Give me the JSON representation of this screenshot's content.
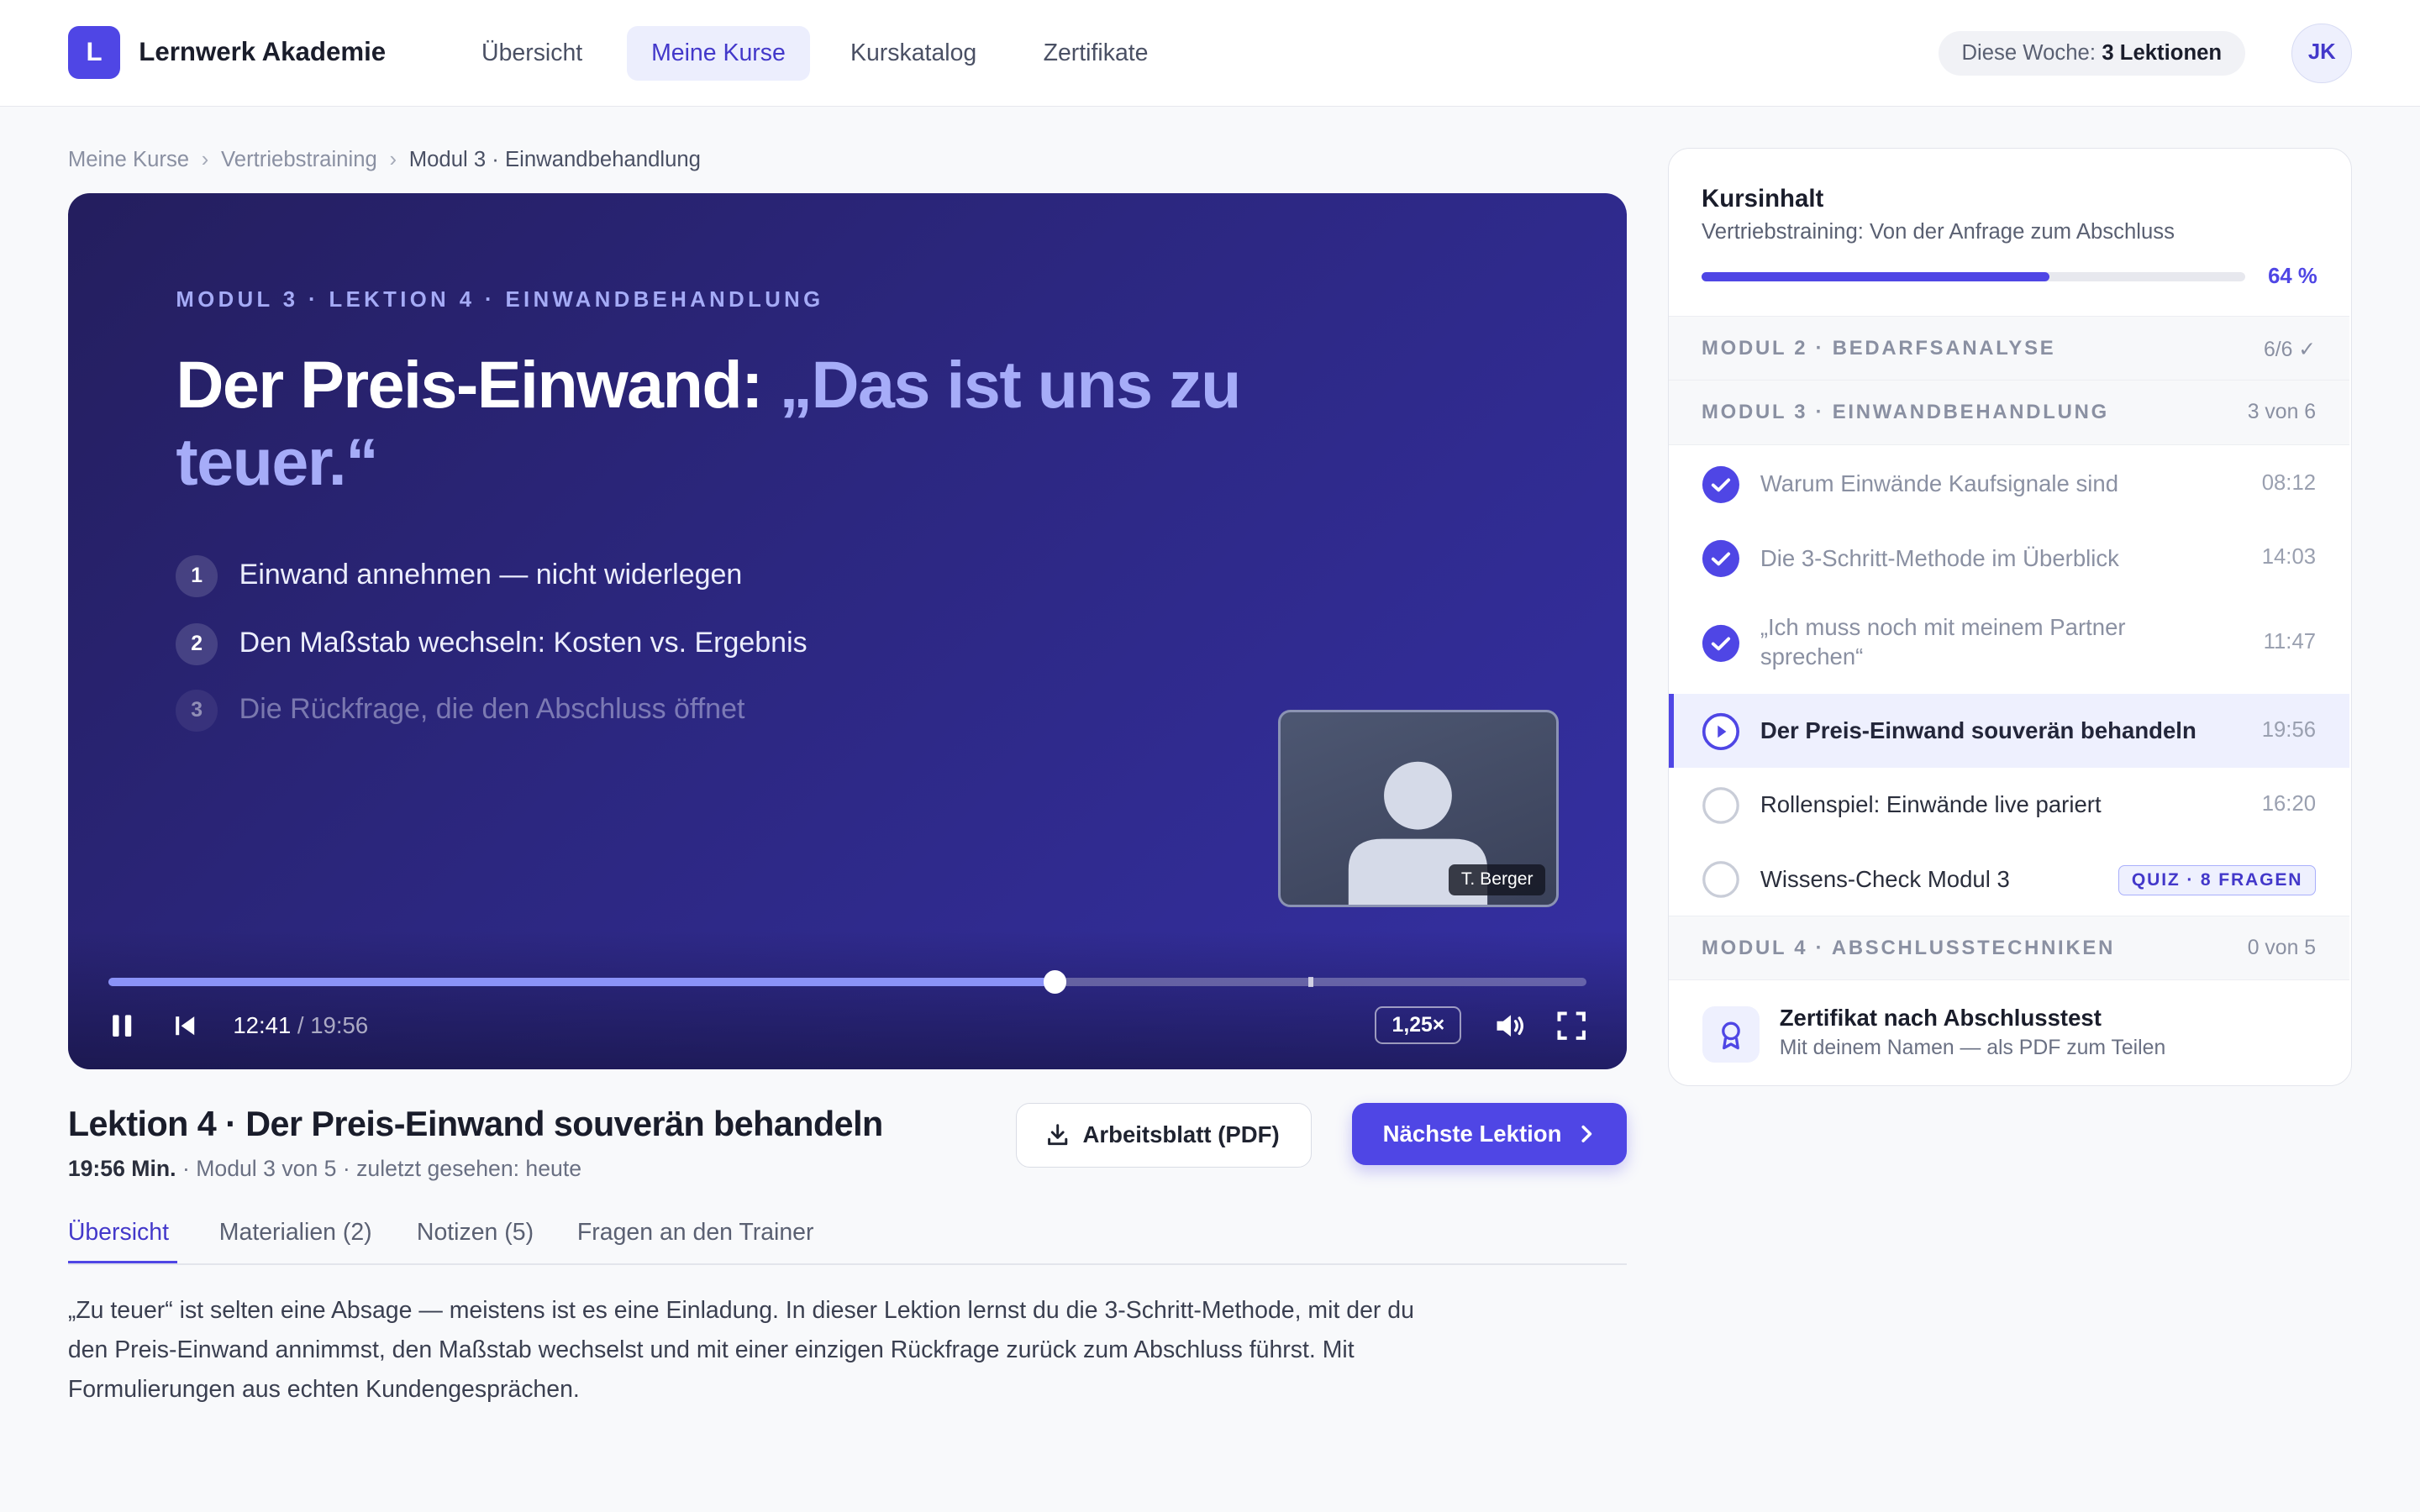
{
  "app": {
    "logo_letter": "L",
    "brand": "Lernwerk Akademie",
    "accent_color": "#4f46e5"
  },
  "nav": {
    "items": [
      {
        "label": "Übersicht",
        "active": false
      },
      {
        "label": "Meine Kurse",
        "active": true
      },
      {
        "label": "Kurskatalog",
        "active": false
      },
      {
        "label": "Zertifikate",
        "active": false
      }
    ]
  },
  "header": {
    "week_label": "Diese Woche:",
    "week_value": "3 Lektionen",
    "avatar_initials": "JK"
  },
  "breadcrumb": {
    "items": [
      "Meine Kurse",
      "Vertriebstraining",
      "Modul 3 · Einwandbehandlung"
    ],
    "separator": "›"
  },
  "video": {
    "eyebrow": "MODUL 3 · LEKTION 4 · EINWANDBEHANDLUNG",
    "title_main": "Der Preis-Einwand: ",
    "title_quote": "„Das ist uns zu teuer.“",
    "points": [
      {
        "num": "1",
        "text": "Einwand annehmen — nicht widerlegen"
      },
      {
        "num": "2",
        "text": "Den Maßstab wechseln: Kosten vs. Ergebnis"
      },
      {
        "num": "3",
        "text": "Die Rückfrage, die den Abschluss öffnet"
      }
    ],
    "presenter_name": "T. Berger",
    "current_time": "12:41",
    "duration": "/ 19:56",
    "progress_fraction": 0.64,
    "chapter_mark_fraction": 0.812,
    "speed": "1,25×",
    "icons": [
      "pause-icon",
      "skip-back-icon",
      "volume-icon",
      "fullscreen-icon"
    ]
  },
  "lesson": {
    "title": "Lektion 4 · Der Preis-Einwand souverän behandeln",
    "length": "19:56 Min.",
    "meta_rest": " · Modul 3 von 5 · zuletzt gesehen: heute",
    "worksheet_button": "Arbeitsblatt (PDF)",
    "next_button": "Nächste Lektion",
    "tabs": [
      {
        "label": "Übersicht",
        "active": true
      },
      {
        "label": "Materialien (2)",
        "active": false
      },
      {
        "label": "Notizen (5)",
        "active": false
      },
      {
        "label": "Fragen an den Trainer",
        "active": false
      }
    ],
    "description": "„Zu teuer“ ist selten eine Absage — meistens ist es eine Einladung. In dieser Lektion lernst du die 3-Schritt-Methode, mit der du den Preis-Einwand annimmst, den Maßstab wechselst und mit einer einzigen Rückfrage zurück zum Abschluss führst. Mit Formulierungen aus echten Kundengesprächen."
  },
  "sidebar": {
    "heading": "Kursinhalt",
    "course_name": "Vertriebstraining: Von der Anfrage zum Abschluss",
    "progress_label": "64 %",
    "progress_fraction": 0.64,
    "modules": [
      {
        "name": "MODUL 2 · BEDARFSANALYSE",
        "count": "6/6 ✓"
      },
      {
        "name": "MODUL 3 · EINWANDBEHANDLUNG",
        "count": "3 von 6"
      },
      {
        "name": "MODUL 4 · ABSCHLUSSTECHNIKEN",
        "count": "0 von 5"
      }
    ],
    "lessons": [
      {
        "title": "Warum Einwände Kaufsignale sind",
        "duration": "08:12",
        "status": "done"
      },
      {
        "title": "Die 3-Schritt-Methode im Überblick",
        "duration": "14:03",
        "status": "done"
      },
      {
        "title": "„Ich muss noch mit meinem Partner sprechen“",
        "duration": "11:47",
        "status": "done"
      },
      {
        "title": "Der Preis-Einwand souverän behandeln",
        "duration": "19:56",
        "status": "current"
      },
      {
        "title": "Rollenspiel: Einwände live pariert",
        "duration": "16:20",
        "status": "todo"
      },
      {
        "title": "Wissens-Check Modul 3",
        "badge": "QUIZ · 8 FRAGEN",
        "status": "todo"
      }
    ],
    "certificate": {
      "title": "Zertifikat nach Abschlusstest",
      "subtitle": "Mit deinem Namen — als PDF zum Teilen"
    }
  }
}
